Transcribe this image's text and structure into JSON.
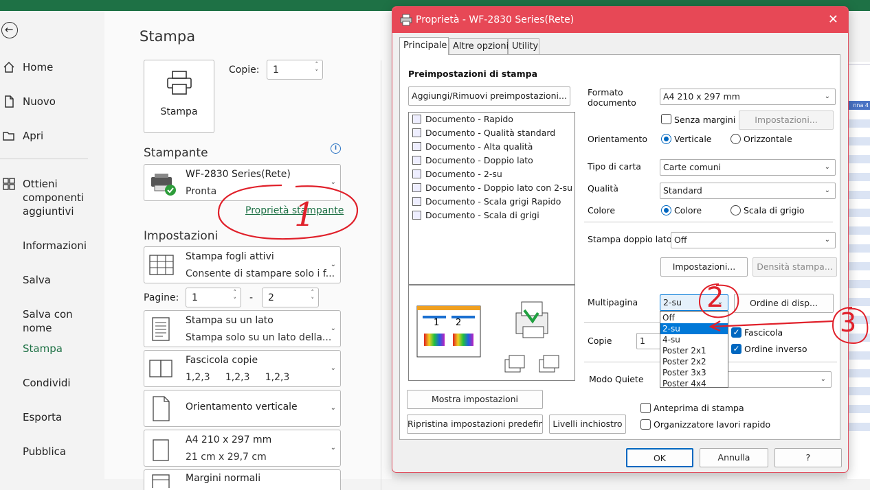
{
  "nav": {
    "items": [
      "Home",
      "Nuovo",
      "Apri",
      "Ottieni componenti aggiuntivi",
      "Informazioni",
      "Salva",
      "Salva con nome",
      "Stampa",
      "Condividi",
      "Esporta",
      "Pubblica"
    ]
  },
  "print": {
    "title": "Stampa",
    "print_button": "Stampa",
    "copies_label": "Copie:",
    "copies_value": "1",
    "printer_section": "Stampante",
    "printer_name": "WF-2830 Series(Rete)",
    "printer_status": "Pronta",
    "printer_properties_link": "Proprietà stampante",
    "settings_section": "Impostazioni",
    "settings": [
      {
        "l1": "Stampa fogli attivi",
        "l2": "Consente di stampare solo i f..."
      },
      {
        "l1": "Stampa su un lato",
        "l2": "Stampa solo su un lato della..."
      },
      {
        "l1": "Fascicola copie",
        "l2": "1,2,3     1,2,3     1,2,3"
      },
      {
        "l1": "Orientamento verticale",
        "l2": ""
      },
      {
        "l1": "A4 210 x 297 mm",
        "l2": "21 cm x 29,7 cm"
      },
      {
        "l1": "Margini normali",
        "l2": ""
      }
    ],
    "pages_label": "Pagine:",
    "pages_from": "1",
    "pages_dash": "-",
    "pages_to": "2"
  },
  "preview": {
    "header_text": "nna 4"
  },
  "dialog": {
    "title": "Proprietà - WF-2830 Series(Rete)",
    "close_glyph": "✕",
    "tabs": [
      "Principale",
      "Altre opzioni",
      "Utility"
    ],
    "presets_heading": "Preimpostazioni di stampa",
    "add_remove_button": "Aggiungi/Rimuovi preimpostazioni...",
    "presets": [
      "Documento - Rapido",
      "Documento - Qualità standard",
      "Documento - Alta qualità",
      "Documento - Doppio lato",
      "Documento - 2-su",
      "Documento - Doppio lato con 2-su",
      "Documento - Scala grigi Rapido",
      "Documento - Scala di grigi"
    ],
    "show_settings_button": "Mostra impostazioni",
    "restore_defaults_button": "Ripristina impostazioni predefinite",
    "ink_levels_button": "Livelli inchiostro",
    "paper_size_label": "Formato\ndocumento",
    "paper_size_value": "A4 210 x 297 mm",
    "borderless_label": "Senza margini",
    "borderless_settings_button": "Impostazioni...",
    "orientation_label": "Orientamento",
    "orientation_portrait": "Verticale",
    "orientation_landscape": "Orizzontale",
    "paper_type_label": "Tipo di carta",
    "paper_type_value": "Carte comuni",
    "quality_label": "Qualità",
    "quality_value": "Standard",
    "color_label": "Colore",
    "color_color": "Colore",
    "color_gray": "Scala di grigio",
    "duplex_label": "Stampa doppio lato",
    "duplex_value": "Off",
    "duplex_settings_button": "Impostazioni...",
    "density_button": "Densità stampa...",
    "multipage_label": "Multipagina",
    "multipage_value": "2-su",
    "page_order_button": "Ordine di disp...",
    "multipage_options": [
      "Off",
      "2-su",
      "4-su",
      "Poster 2x1",
      "Poster 2x2",
      "Poster 3x3",
      "Poster 4x4"
    ],
    "copies_label": "Copie",
    "copies_value": "1",
    "collate_label": "Fascicola",
    "reverse_label": "Ordine inverso",
    "quiet_label": "Modo Quiete",
    "print_preview_label": "Anteprima di stampa",
    "job_arranger_label": "Organizzatore lavori rapido",
    "ok_button": "OK",
    "cancel_button": "Annulla",
    "help_button": "?"
  },
  "annotations": {
    "one": "1",
    "two": "2",
    "three": "3"
  },
  "colors": {
    "excel_green": "#1e7145",
    "title_red": "#e74856",
    "accent_blue": "#0067c0",
    "annotation_red": "#e0202a"
  }
}
